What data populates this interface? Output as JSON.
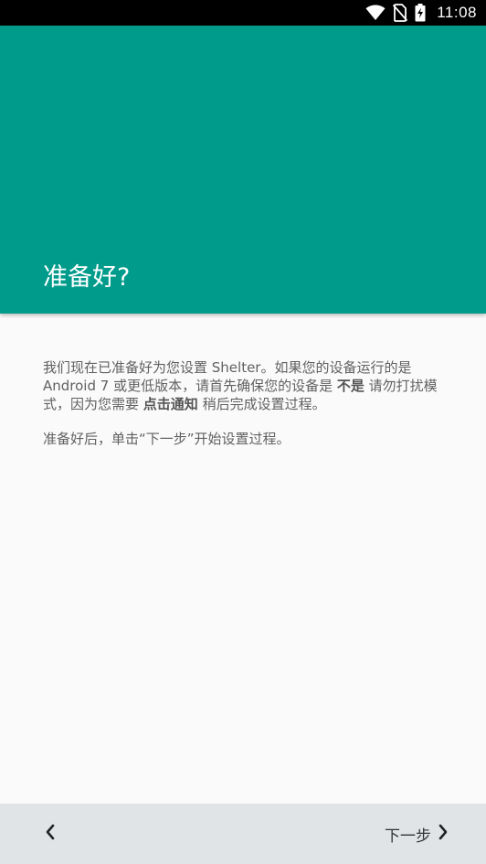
{
  "status_bar": {
    "time": "11:08",
    "icons": [
      "wifi-icon",
      "no-sim-icon",
      "battery-charging-icon"
    ]
  },
  "header": {
    "title": "准备好?",
    "background_color": "#009b8b"
  },
  "content": {
    "para1_part1": "我们现在已准备好为您设置 Shelter。如果您的设备运行的是 Android 7 或更低版本，请首先确保您的设备是 ",
    "para1_bold1": "不是",
    "para1_part2": " 请勿打扰模式，因为您需要 ",
    "para1_bold2": "点击通知",
    "para1_part3": " 稍后完成设置过程。",
    "para2": "准备好后，单击“下一步”开始设置过程。"
  },
  "bottom_bar": {
    "back_icon": "chevron-left-icon",
    "next_label": "下一步",
    "next_icon": "chevron-right-icon"
  }
}
